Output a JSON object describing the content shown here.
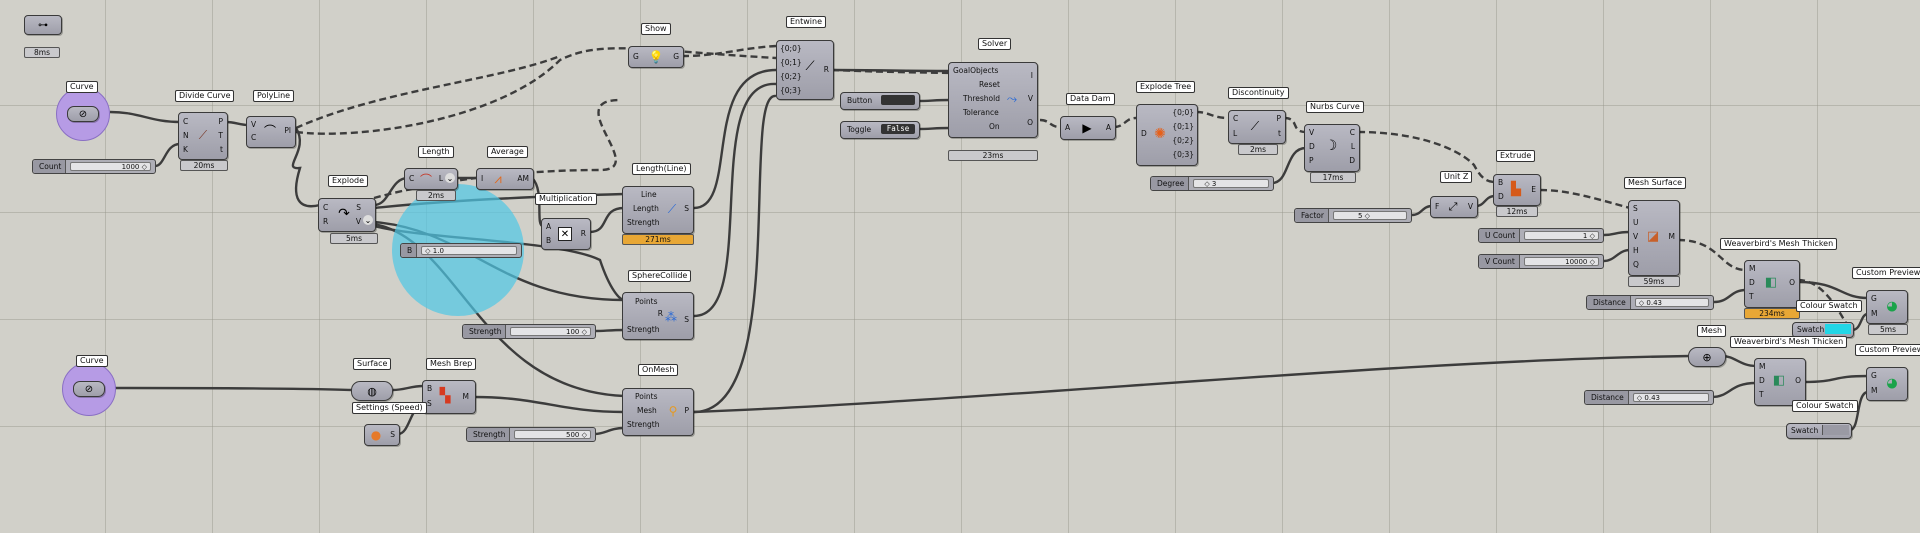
{
  "canvas_tools": {
    "top_left_icon": "cluster-icon",
    "top_left_time": "8ms"
  },
  "nodes": {
    "curve1": {
      "label": "Curve"
    },
    "curve2": {
      "label": "Curve"
    },
    "count_slider": {
      "name": "Count",
      "value": "1000"
    },
    "divide_curve": {
      "label": "Divide Curve",
      "inputs": [
        "C",
        "N",
        "K"
      ],
      "outputs": [
        "P",
        "T",
        "t"
      ],
      "time": "20ms"
    },
    "polyline": {
      "label": "PolyLine",
      "inputs": [
        "V",
        "C"
      ],
      "outputs": [
        "Pl"
      ]
    },
    "explode": {
      "label": "Explode",
      "inputs": [
        "C",
        "R"
      ],
      "outputs": [
        "S",
        "V"
      ],
      "time": "5ms"
    },
    "length": {
      "label": "Length",
      "inputs": [
        "C"
      ],
      "outputs": [
        "L"
      ],
      "time": "2ms"
    },
    "average": {
      "label": "Average",
      "inputs": [
        "I"
      ],
      "outputs": [
        "AM"
      ]
    },
    "multiplication": {
      "label": "Multiplication",
      "inputs": [
        "A",
        "B"
      ],
      "outputs": [
        "R"
      ]
    },
    "b_slider": {
      "name": "B",
      "value": "1.0"
    },
    "show": {
      "label": "Show",
      "inputs": [
        "G"
      ],
      "outputs": [
        "G"
      ]
    },
    "entwine": {
      "label": "Entwine",
      "inputs": [
        "{0;0}",
        "{0;1}",
        "{0;2}",
        "{0;3}"
      ],
      "outputs": [
        "R"
      ]
    },
    "length_line": {
      "label": "Length(Line)",
      "inputs": [
        "Line",
        "Length",
        "Strength"
      ],
      "outputs": [
        "S"
      ],
      "time": "271ms"
    },
    "sphere_collide": {
      "label": "SphereCollide",
      "inputs": [
        "Points",
        "Strength"
      ],
      "outputs": [
        "R",
        "S"
      ]
    },
    "strength_slider1": {
      "name": "Strength",
      "value": "100"
    },
    "surface": {
      "label": "Surface"
    },
    "mesh_brep": {
      "label": "Mesh Brep",
      "inputs": [
        "B",
        "S"
      ],
      "outputs": [
        "M"
      ]
    },
    "settings_speed": {
      "label": "Settings (Speed)",
      "outputs": [
        "S"
      ]
    },
    "onmesh": {
      "label": "OnMesh",
      "inputs": [
        "Points",
        "Mesh",
        "Strength"
      ],
      "outputs": [
        "P"
      ]
    },
    "strength_slider2": {
      "name": "Strength",
      "value": "500"
    },
    "solver": {
      "label": "Solver",
      "inputs": [
        "GoalObjects",
        "Reset",
        "Threshold",
        "Tolerance",
        "On"
      ],
      "outputs": [
        "I",
        "V",
        "O"
      ],
      "time": "23ms"
    },
    "button": {
      "label": "Button"
    },
    "toggle": {
      "label": "Toggle",
      "value": "False"
    },
    "data_dam": {
      "label": "Data Dam",
      "inputs": [
        "A"
      ],
      "outputs": [
        "A"
      ]
    },
    "explode_tree": {
      "label": "Explode Tree",
      "inputs": [
        "D"
      ],
      "outputs": [
        "{0;0}",
        "{0;1}",
        "{0;2}",
        "{0;3}"
      ]
    },
    "discontinuity": {
      "label": "Discontinuity",
      "inputs": [
        "C",
        "L"
      ],
      "outputs": [
        "P",
        "t"
      ],
      "time": "2ms"
    },
    "degree_slider": {
      "name": "Degree",
      "value": "3"
    },
    "nurbs_curve": {
      "label": "Nurbs Curve",
      "inputs": [
        "V",
        "D",
        "P"
      ],
      "outputs": [
        "C",
        "L",
        "D"
      ],
      "time": "17ms"
    },
    "unit_z": {
      "label": "Unit Z",
      "inputs": [
        "F"
      ],
      "outputs": [
        "V"
      ]
    },
    "factor_slider": {
      "name": "Factor",
      "value": "5"
    },
    "extrude": {
      "label": "Extrude",
      "inputs": [
        "B",
        "D"
      ],
      "outputs": [
        "E"
      ],
      "time": "12ms"
    },
    "mesh_surface": {
      "label": "Mesh Surface",
      "inputs": [
        "S",
        "U",
        "V",
        "H",
        "Q"
      ],
      "outputs": [
        "M"
      ],
      "time": "59ms"
    },
    "ucount_slider": {
      "name": "U Count",
      "value": "1"
    },
    "vcount_slider": {
      "name": "V Count",
      "value": "10000"
    },
    "wb_thicken1": {
      "label": "Weaverbird's Mesh Thicken",
      "inputs": [
        "M",
        "D",
        "T"
      ],
      "outputs": [
        "O"
      ],
      "time": "234ms"
    },
    "distance_slider1": {
      "name": "Distance",
      "value": "0.43"
    },
    "colour_swatch1": {
      "label": "Colour Swatch",
      "name": "Swatch",
      "color": "#22d6e6"
    },
    "custom_preview1": {
      "label": "Custom Preview",
      "inputs": [
        "G",
        "M"
      ],
      "time": "5ms"
    },
    "mesh": {
      "label": "Mesh"
    },
    "wb_thicken2": {
      "label": "Weaverbird's Mesh Thicken",
      "inputs": [
        "M",
        "D",
        "T"
      ],
      "outputs": [
        "O"
      ]
    },
    "distance_slider2": {
      "name": "Distance",
      "value": "0.43"
    },
    "colour_swatch2": {
      "label": "Colour Swatch",
      "name": "Swatch",
      "color": "#9a9aa4"
    },
    "custom_preview2": {
      "label": "Custom Preview",
      "inputs": [
        "G",
        "M"
      ]
    }
  },
  "colors": {
    "canvas": "#d1d0c9",
    "component": "#a9a9b3",
    "geometry_param": "#b69be5",
    "selection_circle": "#4fc8e6",
    "timer_warning": "#e8a735"
  }
}
